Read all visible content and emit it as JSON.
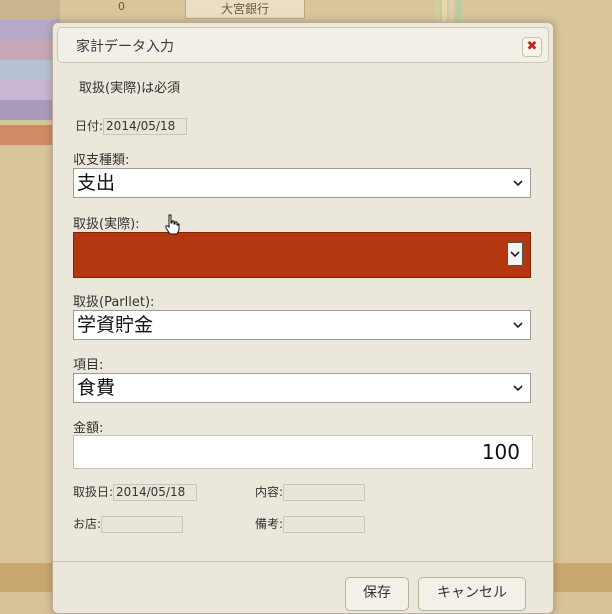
{
  "background": {
    "zero_label": "0",
    "bank_label": "大宮銀行",
    "row_colors": [
      "#b7a9c8",
      "#c9a7b8",
      "#b7c1d6",
      "#c7b7d4",
      "#a99bb9",
      "#d28a62",
      "#c9b58f"
    ],
    "stripe_colors": [
      "#c8d49c",
      "#e4d8a9",
      "#d9d0b0",
      "#b9cda2"
    ]
  },
  "dialog": {
    "title": "家計データ入力",
    "close_symbol": "✖",
    "required_note": "取扱(実際)は必須",
    "date_label": "日付:",
    "date_value": "2014/05/18",
    "type_label": "収支種類:",
    "type_value": "支出",
    "actual_label": "取扱(実際):",
    "actual_value": "",
    "parllet_label": "取扱(Parllet):",
    "parllet_value": "学資貯金",
    "item_label": "項目:",
    "item_value": "食費",
    "amount_label": "金額:",
    "amount_value": "100",
    "trade_date_label": "取扱日:",
    "trade_date_value": "2014/05/18",
    "content_label": "内容:",
    "content_value": "",
    "shop_label": "お店:",
    "shop_value": "",
    "memo_label": "備考:",
    "memo_value": "",
    "save_label": "保存",
    "cancel_label": "キャンセル",
    "chevron_symbol": "⌄",
    "accent_red": "#b4370f"
  }
}
